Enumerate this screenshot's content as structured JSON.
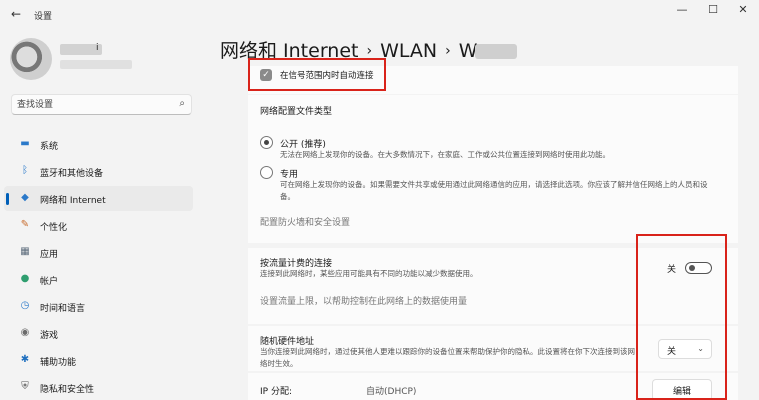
{
  "window": {
    "title": "设置",
    "minimize_icon": "minimize-icon",
    "maximize_icon": "maximize-icon",
    "close_icon": "close-icon"
  },
  "user": {
    "name_suffix": "i"
  },
  "search": {
    "placeholder": "查找设置"
  },
  "sidebar": {
    "items": [
      {
        "label": "系统",
        "icon": "monitor-icon",
        "icon_color": "#2b79c9"
      },
      {
        "label": "蓝牙和其他设备",
        "icon": "bluetooth-icon",
        "icon_color": "#2b79c9"
      },
      {
        "label": "网络和 Internet",
        "icon": "wifi-icon",
        "icon_color": "#2b79c9",
        "active": true
      },
      {
        "label": "个性化",
        "icon": "brush-icon",
        "icon_color": "#c76a2a"
      },
      {
        "label": "应用",
        "icon": "apps-icon",
        "icon_color": "#5a6a7a"
      },
      {
        "label": "帐户",
        "icon": "person-icon",
        "icon_color": "#2f9e6f"
      },
      {
        "label": "时间和语言",
        "icon": "globe-clock-icon",
        "icon_color": "#2b79c9"
      },
      {
        "label": "游戏",
        "icon": "gamepad-icon",
        "icon_color": "#6b6b6b"
      },
      {
        "label": "辅助功能",
        "icon": "accessibility-icon",
        "icon_color": "#1f6fbf"
      },
      {
        "label": "隐私和安全性",
        "icon": "shield-icon",
        "icon_color": "#555555"
      }
    ]
  },
  "breadcrumb": {
    "part1": "网络和 Internet",
    "sep": "›",
    "part2": "WLAN",
    "part3": "W"
  },
  "content": {
    "auto_connect_label": "在信号范围内时自动连接",
    "profile_type_title": "网络配置文件类型",
    "public_label": "公开 (推荐)",
    "public_desc": "无法在网络上发现你的设备。在大多数情况下，在家庭、工作或公共位置连接到网络时使用此功能。",
    "private_label": "专用",
    "private_desc": "可在网络上发现你的设备。如果需要文件共享或使用通过此网络通信的应用，请选择此选项。你应该了解并信任网络上的人员和设备。",
    "firewall_link": "配置防火墙和安全设置",
    "metered_title": "按流量计费的连接",
    "metered_desc": "连接到此网络时，某些应用可能具有不同的功能以减少数据使用。",
    "metered_state": "关",
    "data_limit_link": "设置流量上限，以帮助控制在此网络上的数据使用量",
    "random_mac_title": "随机硬件地址",
    "random_mac_desc": "当你连接到此网络时，通过使其他人更难以跟踪你的设备位置来帮助保护你的隐私。此设置将在你下次连接到该网络时生效。",
    "random_mac_value": "关",
    "ip_label": "IP 分配:",
    "ip_value": "自动(DHCP)",
    "edit_button": "编辑"
  },
  "highlight_color": "#d9231a"
}
